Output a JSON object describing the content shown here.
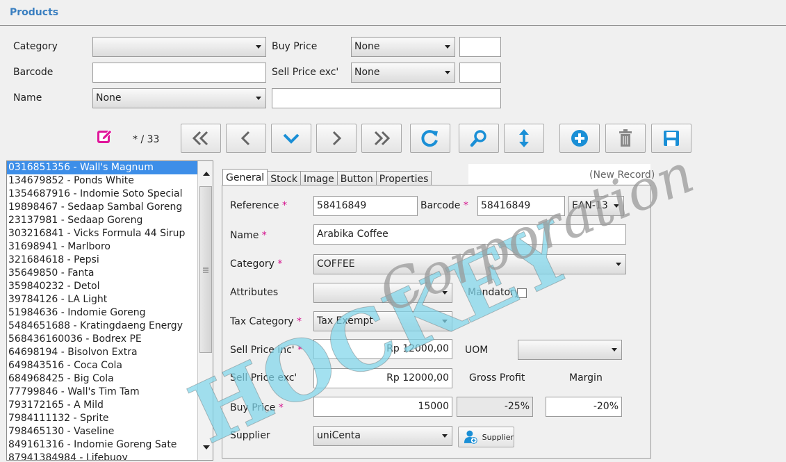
{
  "header": {
    "title": "Products"
  },
  "filters": {
    "category_label": "Category",
    "category_value": "",
    "buy_price_label": "Buy Price",
    "buy_price_op": "None",
    "buy_price_value": "",
    "barcode_label": "Barcode",
    "barcode_value": "",
    "sell_price_label": "Sell Price exc'",
    "sell_price_op": "None",
    "sell_price_value": "",
    "name_label": "Name",
    "name_op": "None",
    "name_value": ""
  },
  "toolbar": {
    "record_counter": "* / 33"
  },
  "product_list": {
    "items": [
      "0316851356 - Wall's Magnum",
      "134679852 - Ponds White",
      "1354687916 - Indomie Soto Special",
      "19898467 - Sedaap Sambal Goreng",
      "23137981 - Sedaap Goreng",
      "303216841 - Vicks Formula 44 Sirup",
      "31698941 - Marlboro",
      "321684618 - Pepsi",
      "35649850 - Fanta",
      "359840232 - Detol",
      "39784126 - LA Light",
      "51984636 - Indomie Goreng",
      "5484651688 - Kratingdaeng Energy",
      "568436160036 - Bodrex PE",
      "64698194 - Bisolvon Extra",
      "649843516 - Coca Cola",
      "684968425 - Big Cola",
      "77799846 - Wall's Tim Tam",
      "793172165 - A Mild",
      "7984111132 - Sprite",
      "798465130 - Vaseline",
      "849161316 - Indomie Goreng Sate",
      "87941384984 - Lifebuoy"
    ]
  },
  "tabs": [
    "General",
    "Stock",
    "Image",
    "Button",
    "Properties"
  ],
  "record_status": "(New Record)",
  "form": {
    "reference_label": "Reference",
    "reference_value": "58416849",
    "barcode_label": "Barcode",
    "barcode_value": "58416849",
    "barcode_type": "EAN-13",
    "name_label": "Name",
    "name_value": "Arabika Coffee",
    "category_label": "Category",
    "category_value": "COFFEE",
    "attributes_label": "Attributes",
    "attributes_value": "",
    "mandatory_label": "Mandatory",
    "tax_category_label": "Tax Category",
    "tax_category_value": "Tax Exempt",
    "sell_inc_label": "Sell Price inc'",
    "sell_inc_value": "Rp 12000,00",
    "uom_label": "UOM",
    "uom_value": "",
    "sell_exc_label": "Sell Price exc'",
    "sell_exc_value": "Rp 12000,00",
    "gross_profit_label": "Gross Profit",
    "margin_label": "Margin",
    "buy_price_label": "Buy Price",
    "buy_price_value": "15000",
    "gross_profit_value": "-25%",
    "margin_value": "-20%",
    "supplier_label": "Supplier",
    "supplier_value": "uniCenta",
    "supplier_button": "Supplier",
    "required_mark": "*"
  },
  "watermark": {
    "line1": "HOCKEY",
    "line2": "Corporation"
  },
  "colors": {
    "accent": "#3a7fc0",
    "selection": "#3d8ee8",
    "required": "#d4108c",
    "icon_blue": "#1a8fd6"
  }
}
